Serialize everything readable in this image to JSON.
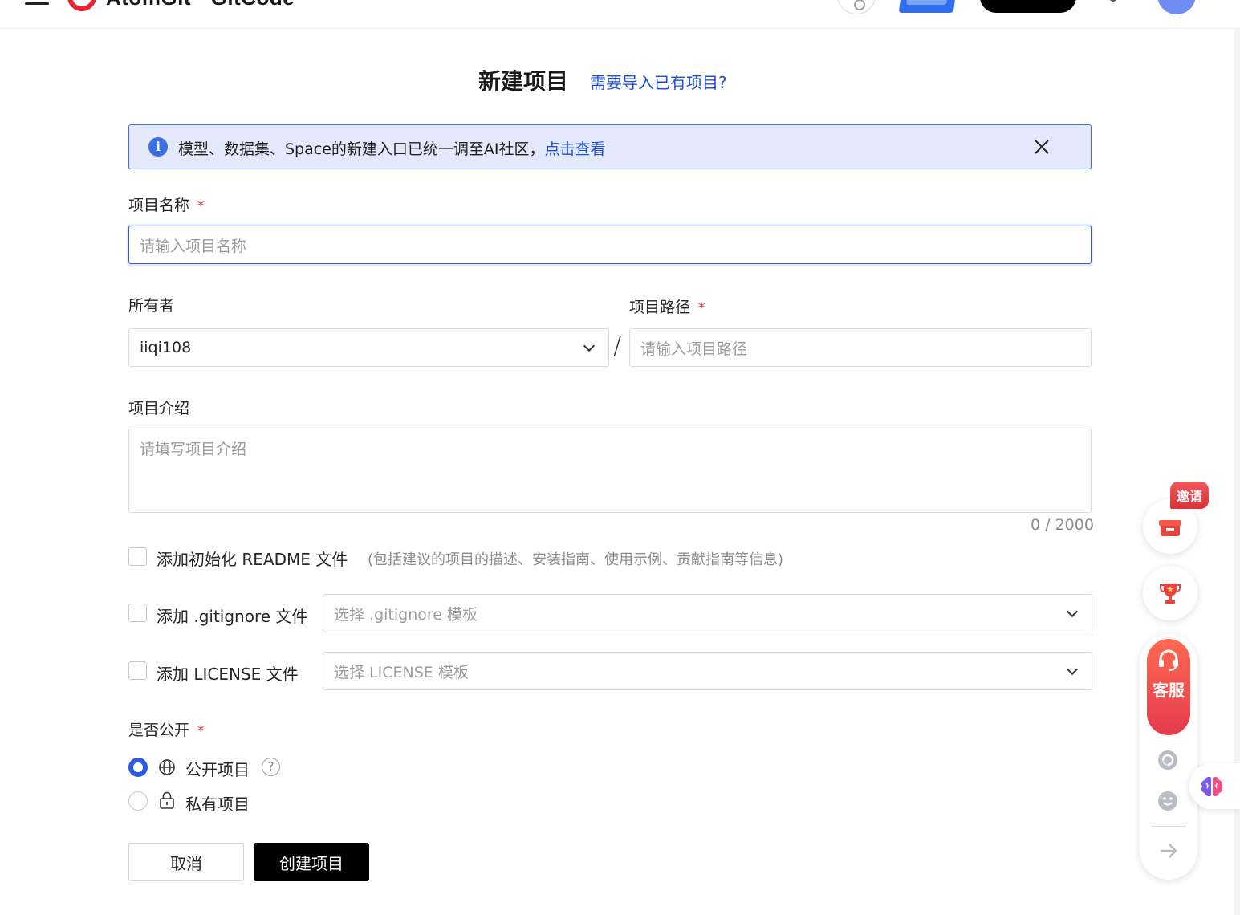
{
  "header": {
    "brand": "AtomGit · GitCode",
    "icons": [
      "menu-icon",
      "logo-icon",
      "search-icon",
      "promo-badge",
      "bell-icon",
      "avatar"
    ]
  },
  "title": {
    "main": "新建项目",
    "import_link": "需要导入已有项目?"
  },
  "notice": {
    "icon": "info-icon",
    "text": "模型、数据集、Space的新建入口已统一调至AI社区，",
    "link": "点击查看",
    "close_icon": "close-icon"
  },
  "form": {
    "name": {
      "label": "项目名称",
      "required_mark": "*",
      "placeholder": "请输入项目名称"
    },
    "owner": {
      "label": "所有者",
      "value": "iiqi108"
    },
    "separator": "/",
    "path": {
      "label": "项目路径",
      "required_mark": "*",
      "placeholder": "请输入项目路径"
    },
    "description": {
      "label": "项目介绍",
      "placeholder": "请填写项目介绍",
      "counter": "0 / 2000"
    },
    "readme": {
      "label": "添加初始化 README 文件",
      "hint": "(包括建议的项目的描述、安装指南、使用示例、贡献指南等信息)",
      "checked": false
    },
    "gitignore": {
      "label": "添加 .gitignore 文件",
      "placeholder": "选择 .gitignore 模板",
      "checked": false
    },
    "license": {
      "label": "添加 LICENSE 文件",
      "placeholder": "选择 LICENSE 模板",
      "checked": false
    },
    "visibility": {
      "label": "是否公开",
      "required_mark": "*",
      "options": [
        {
          "label": "公开项目",
          "icon": "globe-icon",
          "selected": true,
          "help": "?"
        },
        {
          "label": "私有项目",
          "icon": "lock-icon",
          "selected": false
        }
      ]
    }
  },
  "buttons": {
    "cancel": "取消",
    "create": "创建项目"
  },
  "floating": {
    "invite_badge": "邀请",
    "service_label": "客服",
    "icons": [
      "gift-icon",
      "trophy-icon",
      "headset-icon",
      "refresh-icon",
      "smile-icon",
      "arrow-right-icon",
      "brain-icon"
    ]
  },
  "colors": {
    "accent": "#2d5ae0",
    "link": "#1f4fd8",
    "notice_bg": "#e3e9fb",
    "required": "#e5312f",
    "primary_button": "#000000",
    "brand_red": "#e8242f"
  }
}
